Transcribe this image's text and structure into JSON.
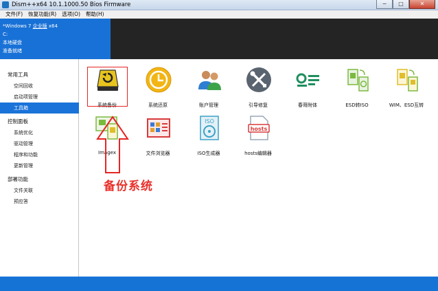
{
  "window": {
    "title": "Dism++x64 10.1.1000.50 Bios Firmware",
    "min": "−",
    "max": "□",
    "close": "✕"
  },
  "menu": [
    "文件(F)",
    "恢复功能(R)",
    "选项(O)",
    "帮助(H)"
  ],
  "info": {
    "os_prefix": "*Windows 7 ",
    "os_edition": "企业版",
    "os_suffix": " x64",
    "drive": "C:",
    "disk": "本地硬盘",
    "status": "准备就绪"
  },
  "sidebar": {
    "groups": [
      {
        "title": "常用工具",
        "items": [
          {
            "label": "空间回收"
          },
          {
            "label": "启动项管理"
          },
          {
            "label": "工具箱",
            "active": true
          }
        ]
      },
      {
        "title": "控制面板",
        "items": [
          {
            "label": "系统优化"
          },
          {
            "label": "驱动管理"
          },
          {
            "label": "程序和功能"
          },
          {
            "label": "更新管理"
          }
        ]
      },
      {
        "title": "部署功能",
        "items": [
          {
            "label": "文件关联"
          },
          {
            "label": "预应答"
          }
        ]
      }
    ]
  },
  "tools": [
    {
      "label": "系统备份",
      "icon": "backup-drive-icon"
    },
    {
      "label": "系统还原",
      "icon": "restore-clock-icon"
    },
    {
      "label": "账户管理",
      "icon": "users-icon"
    },
    {
      "label": "引导修复",
      "icon": "wrench-screwdriver-icon"
    },
    {
      "label": "春哥附体",
      "icon": "admin-toggle-icon"
    },
    {
      "label": "ESD转ISO",
      "icon": "esd-iso-icon"
    },
    {
      "label": "WIM、ESD互转",
      "icon": "wim-esd-icon"
    },
    {
      "label": "Imagex",
      "icon": "imagex-icon"
    },
    {
      "label": "文件浏览器",
      "icon": "file-browser-icon"
    },
    {
      "label": "ISO生成器",
      "icon": "iso-disc-icon"
    },
    {
      "label": "hosts编辑器",
      "icon": "hosts-file-icon"
    }
  ],
  "icon_text": {
    "iso": "ISO",
    "hosts": "hosts"
  },
  "annotation": {
    "text": "备份系统",
    "color": "#e8302a"
  },
  "colors": {
    "accent": "#1871d6",
    "dark_panel": "#242424",
    "selected": "#1a73d9"
  }
}
